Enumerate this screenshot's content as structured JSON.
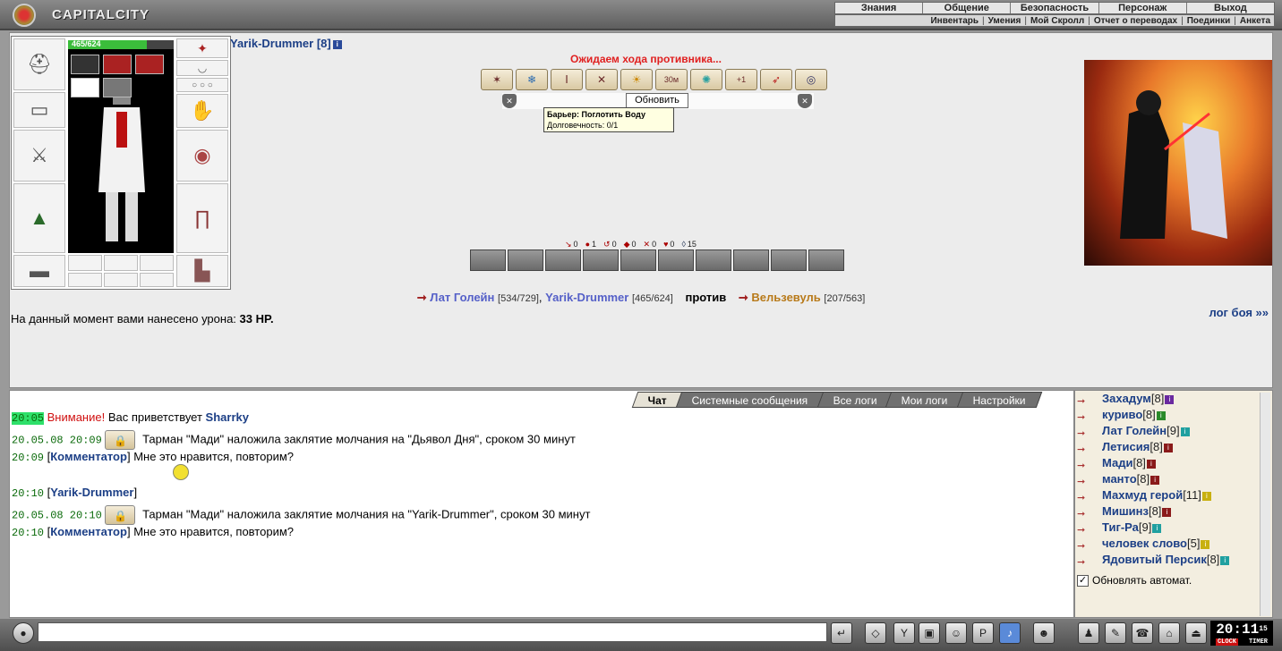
{
  "app": {
    "logo_text": "CAPITALCITY"
  },
  "menu_top": [
    "Знания",
    "Общение",
    "Безопасность",
    "Персонаж",
    "Выход"
  ],
  "menu_sub": [
    "Инвентарь",
    "Умения",
    "Мой Скролл",
    "Отчет о переводах",
    "Поединки",
    "Анкета"
  ],
  "player": {
    "name": "Yarik-Drummer",
    "level": "[8]",
    "hp": "465/624",
    "hp_fraction": 0.745
  },
  "battle": {
    "status": "Ожидаем хода противника...",
    "update_label": "Обновить",
    "tooltip_title": "Барьер: Поглотить Воду",
    "tooltip_detail": "Долговечность: 0/1",
    "spell_badge_30m": "30м",
    "spell_badge_plus1": "+1",
    "stats": [
      "0",
      "1",
      "0",
      "0",
      "0",
      "0",
      "15"
    ],
    "team1_p1_name": "Лат Голейн",
    "team1_p1_hp": "[534/729]",
    "team1_p2_name": "Yarik-Drummer",
    "team1_p2_hp": "[465/624]",
    "vs_label": "против",
    "team2_name": "Вельзевуль",
    "team2_hp": "[207/563]",
    "damage_text": "На данный момент вами нанесено урона:",
    "damage_value": "33 HP.",
    "log_link": "лог боя »»"
  },
  "chat": {
    "tabs": [
      "Чат",
      "Системные сообщения",
      "Все логи",
      "Мои логи",
      "Настройки"
    ],
    "messages": [
      {
        "time": "20:05",
        "pre": "Внимание!",
        "text": "Вас приветствует",
        "who": "Sharrky"
      },
      {
        "time": "20.05.08 20:09",
        "text": "Тарман \"Мади\" наложила заклятие молчания на \"Дьявол Дня\", сроком 30 минут"
      },
      {
        "time": "20:09",
        "who": "Комментатор",
        "text": "Мне это нравится, повторим?"
      },
      {
        "time": "20:10",
        "who": "Yarik-Drummer",
        "text": ""
      },
      {
        "time": "20.05.08 20:10",
        "text": "Тарман \"Мади\" наложила заклятие молчания на \"Yarik-Drummer\", сроком 30 минут"
      },
      {
        "time": "20:10",
        "who": "Комментатор",
        "text": "Мне это нравится, повторим?"
      }
    ]
  },
  "users": [
    {
      "name": "Захадум",
      "level": "[8]",
      "badge": "b-purple"
    },
    {
      "name": "куриво",
      "level": "[8]",
      "badge": "b-green"
    },
    {
      "name": "Лат Голейн",
      "level": "[9]",
      "badge": "b-teal"
    },
    {
      "name": "Летисия",
      "level": "[8]",
      "badge": "b-red"
    },
    {
      "name": "Мади",
      "level": "[8]",
      "badge": "b-red"
    },
    {
      "name": "манто",
      "level": "[8]",
      "badge": "b-red"
    },
    {
      "name": "Махмуд герой",
      "level": "[11]",
      "badge": "b-yellow"
    },
    {
      "name": "Мишинз",
      "level": "[8]",
      "badge": "b-red"
    },
    {
      "name": "Тиг-Ра",
      "level": "[9]",
      "badge": "b-teal"
    },
    {
      "name": "человек слово",
      "level": "[5]",
      "badge": "b-yellow"
    },
    {
      "name": "Ядовитый Персик",
      "level": "[8]",
      "badge": "b-teal"
    }
  ],
  "auto_update_label": "Обновлять автомат.",
  "clock": {
    "time": "20:11",
    "seconds": "15",
    "clock_label": "CLOCK",
    "timer_label": "TIMER"
  }
}
